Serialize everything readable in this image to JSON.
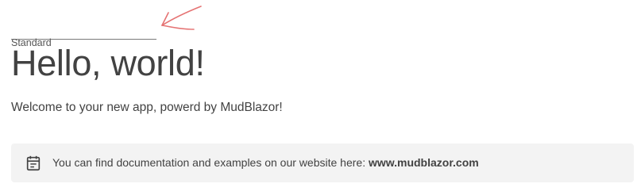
{
  "form": {
    "standard_field_label": "Standard",
    "standard_field_value": ""
  },
  "annotation": {
    "arrow_color": "#e57373",
    "icon": "hand-drawn-arrow-icon"
  },
  "main": {
    "title": "Hello, world!",
    "subtitle": "Welcome to your new app, powerd by MudBlazor!"
  },
  "alert": {
    "icon": "note-icon",
    "text": "You can find documentation and examples on our website here: ",
    "link_text": "www.mudblazor.com",
    "background": "#f3f3f3"
  }
}
